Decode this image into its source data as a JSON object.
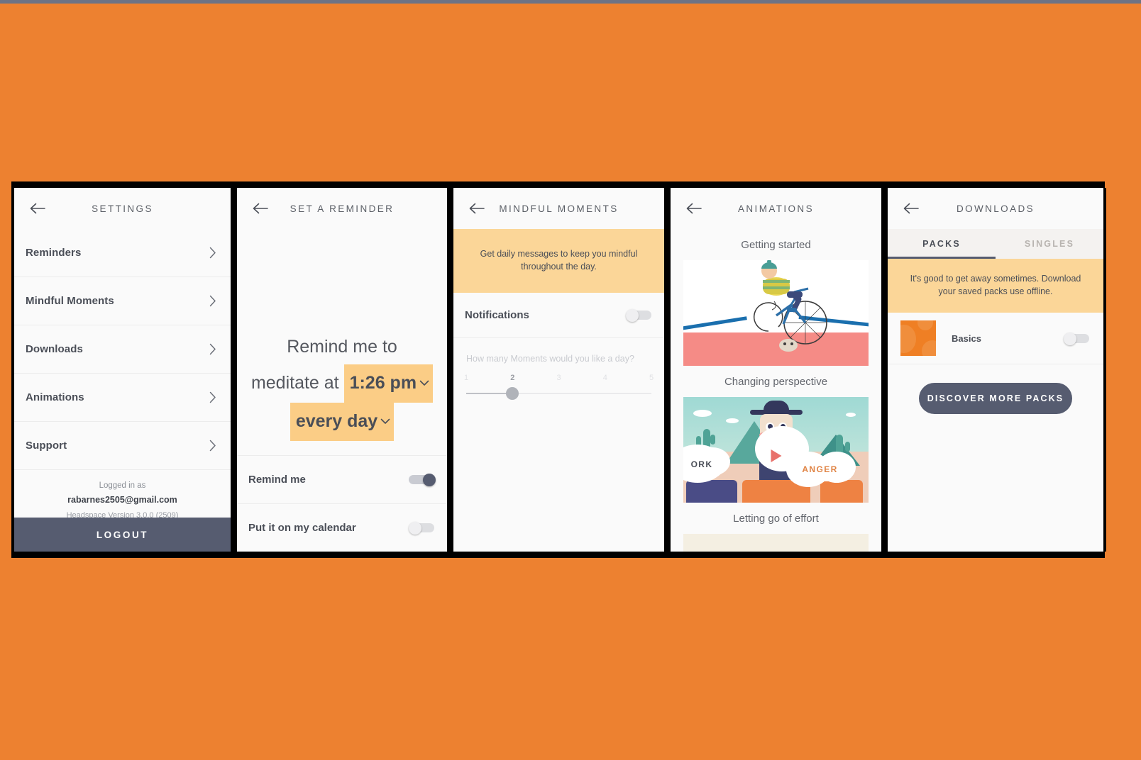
{
  "theme": {
    "background": "#ED8130",
    "top_strip": "#6D7385",
    "accent_dark": "#565C70",
    "banner_amber": "#FBD698",
    "pill_amber": "#FBCD86",
    "frame_border": "#000000"
  },
  "panels": {
    "settings": {
      "title": "SETTINGS",
      "back_icon": "back-arrow-icon",
      "items": [
        {
          "label": "Reminders"
        },
        {
          "label": "Mindful Moments"
        },
        {
          "label": "Downloads"
        },
        {
          "label": "Animations"
        },
        {
          "label": "Support"
        }
      ],
      "account": {
        "logged_in_as": "Logged in as",
        "email": "rabarnes2505@gmail.com",
        "version": "Headspace Version 3.0.0 (2509)"
      },
      "logout_label": "LOGOUT"
    },
    "reminder": {
      "title": "SET A REMINDER",
      "sentence_line1": "Remind me to",
      "sentence_line2_prefix": "meditate at",
      "time_value": "1:26 pm",
      "frequency_value": "every day",
      "rows": [
        {
          "label": "Remind me",
          "state": "on"
        },
        {
          "label": "Put it on my calendar",
          "state": "off"
        }
      ]
    },
    "mindful_moments": {
      "title": "MINDFUL MOMENTS",
      "banner": "Get daily messages to keep you mindful throughout the day.",
      "notifications_label": "Notifications",
      "notifications_state": "off",
      "slider_question": "How many Moments would you like a day?",
      "slider_ticks": [
        "1",
        "2",
        "3",
        "4",
        "5"
      ],
      "slider_value": "2"
    },
    "animations": {
      "title": "ANIMATIONS",
      "cards": [
        {
          "title": "Getting started"
        },
        {
          "title": "Changing perspective",
          "word_left": "ORK",
          "word_right": "ANGER"
        },
        {
          "title": "Letting go of effort"
        }
      ]
    },
    "downloads": {
      "title": "DOWNLOADS",
      "tabs": [
        {
          "label": "PACKS",
          "active": true
        },
        {
          "label": "SINGLES",
          "active": false
        }
      ],
      "banner": "It's good to get away sometimes. Download your saved packs use offline.",
      "packs": [
        {
          "name": "Basics",
          "state": "off"
        }
      ],
      "discover_label": "DISCOVER MORE PACKS"
    }
  }
}
